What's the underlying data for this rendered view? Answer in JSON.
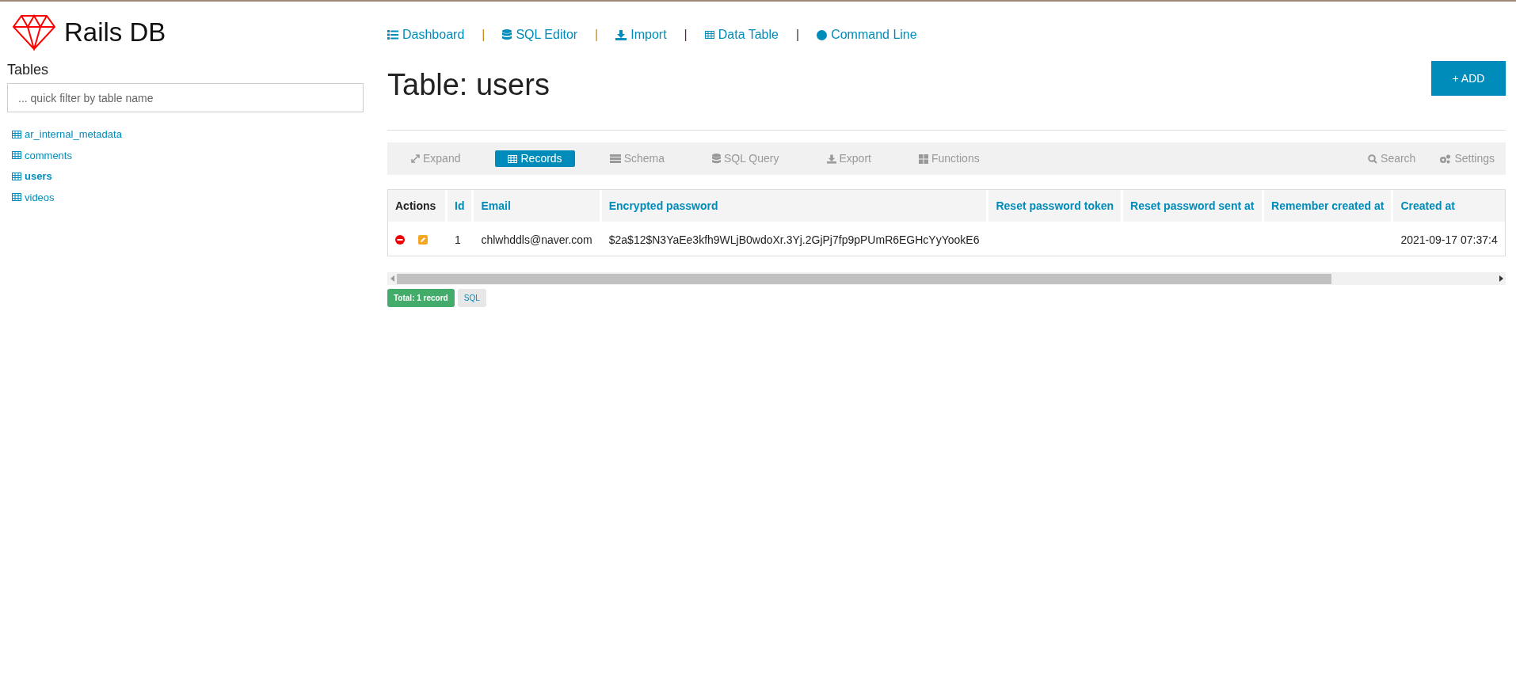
{
  "logo": {
    "title": "Rails DB"
  },
  "sidebar": {
    "heading": "Tables",
    "filter": {
      "placeholder": "... quick filter by table name"
    },
    "tables": [
      {
        "label": "ar_internal_metadata",
        "selected": false
      },
      {
        "label": "comments",
        "selected": false
      },
      {
        "label": "users",
        "selected": true
      },
      {
        "label": "videos",
        "selected": false
      }
    ]
  },
  "nav": [
    {
      "label": "Dashboard"
    },
    {
      "label": "SQL Editor"
    },
    {
      "label": "Import"
    },
    {
      "label": "Data Table"
    },
    {
      "label": "Command Line"
    }
  ],
  "nav_separators": [
    "|",
    "|",
    "|",
    "|"
  ],
  "page_title": "Table: users",
  "add_button": "+ ADD",
  "toolbar": {
    "left": [
      {
        "label": "Expand",
        "selected": false
      },
      {
        "label": "Records",
        "selected": true
      },
      {
        "label": "Schema",
        "selected": false
      },
      {
        "label": "SQL Query",
        "selected": false
      },
      {
        "label": "Export",
        "selected": false
      },
      {
        "label": "Functions",
        "selected": false
      }
    ],
    "right": [
      {
        "label": "Search"
      },
      {
        "label": "Settings"
      }
    ]
  },
  "table": {
    "columns": [
      "Actions",
      "Id",
      "Email",
      "Encrypted password",
      "Reset password token",
      "Reset password sent at",
      "Remember created at",
      "Created at"
    ],
    "rows": [
      {
        "cells": [
          "",
          "1",
          "chlwhddls@naver.com",
          "$2a$12$N3YaEe3kfh9WLjB0wdoXr.3Yj.2GjPj7fp9pPUmR6EGHcYyYookE6",
          null,
          null,
          null,
          "2021-09-17 07:37:4"
        ]
      }
    ]
  },
  "footer": {
    "total": "Total: 1 record",
    "sql": "SQL"
  }
}
